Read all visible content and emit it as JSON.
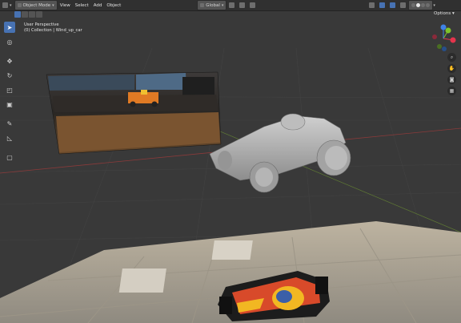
{
  "header": {
    "mode_label": "Object Mode",
    "menus": [
      "View",
      "Select",
      "Add",
      "Object"
    ],
    "transform_orientation": "Global",
    "options_label": "Options"
  },
  "viewport": {
    "view_name": "User Perspective",
    "collection_path": "(0) Collection | Wind_up_car"
  },
  "gizmo": {
    "axes": [
      "X",
      "Y",
      "Z"
    ],
    "colors": {
      "x": "#e5344c",
      "y": "#7ec42a",
      "z": "#3f82e6"
    }
  },
  "toolbar": {
    "tools": [
      "select-box",
      "cursor",
      "move",
      "rotate",
      "scale",
      "transform",
      "annotate",
      "measure",
      "add-cube"
    ]
  },
  "colors": {
    "viewport_bg": "#393939",
    "header_bg": "#303030",
    "accent": "#4772b3"
  }
}
